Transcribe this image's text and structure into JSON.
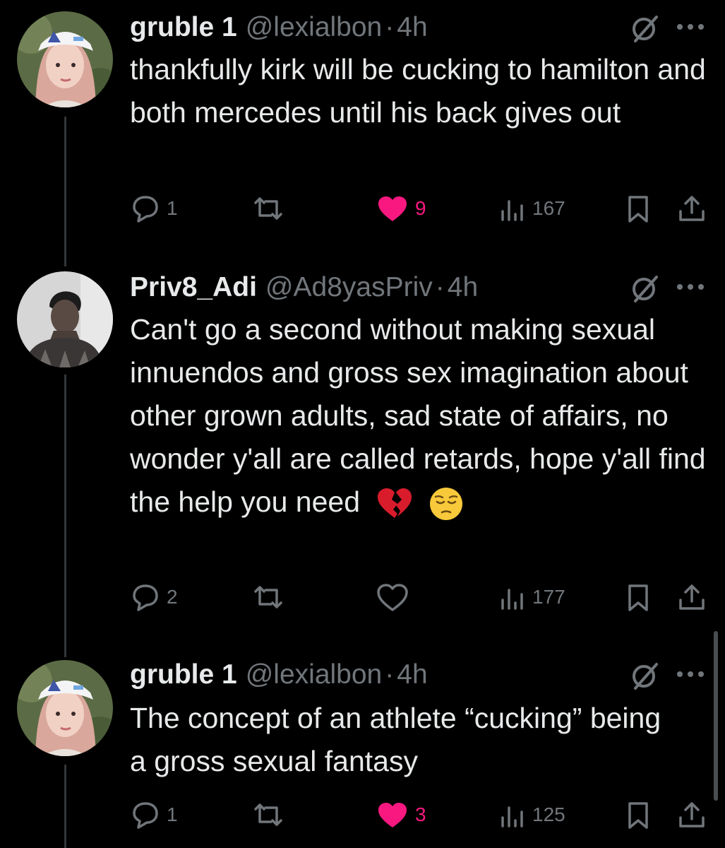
{
  "tweets": [
    {
      "display_name": "gruble 1",
      "handle": "@lexialbon",
      "separator": "·",
      "time": "4h",
      "text": "thankfully kirk will be cucking to hamilton and both mercedes until his back gives out",
      "replies": "1",
      "reposts": "",
      "likes": "9",
      "liked": true,
      "views": "167"
    },
    {
      "display_name": "Priv8_Adi",
      "handle": "@Ad8yasPriv",
      "separator": "·",
      "time": "4h",
      "text": "Can't go a second without making sexual innuendos and gross sex imagination about other grown adults, sad state of affairs, no wonder y'all are called retards, hope y'all find the help you need",
      "emojis": [
        "broken-heart",
        "pensive-face"
      ],
      "replies": "2",
      "reposts": "",
      "likes": "",
      "liked": false,
      "views": "177"
    },
    {
      "display_name": "gruble 1",
      "handle": "@lexialbon",
      "separator": "·",
      "time": "4h",
      "text": "The concept of an athlete “cucking” being a gross sexual fantasy",
      "replies": "1",
      "reposts": "",
      "likes": "3",
      "liked": true,
      "views": "125"
    }
  ],
  "colors": {
    "background": "#000000",
    "text": "#e7e9ea",
    "secondary": "#71767b",
    "like": "#f91880",
    "thread_line": "#333639"
  },
  "icons": [
    "reply-icon",
    "repost-icon",
    "like-icon",
    "views-icon",
    "bookmark-icon",
    "share-icon",
    "grok-icon",
    "more-icon"
  ]
}
